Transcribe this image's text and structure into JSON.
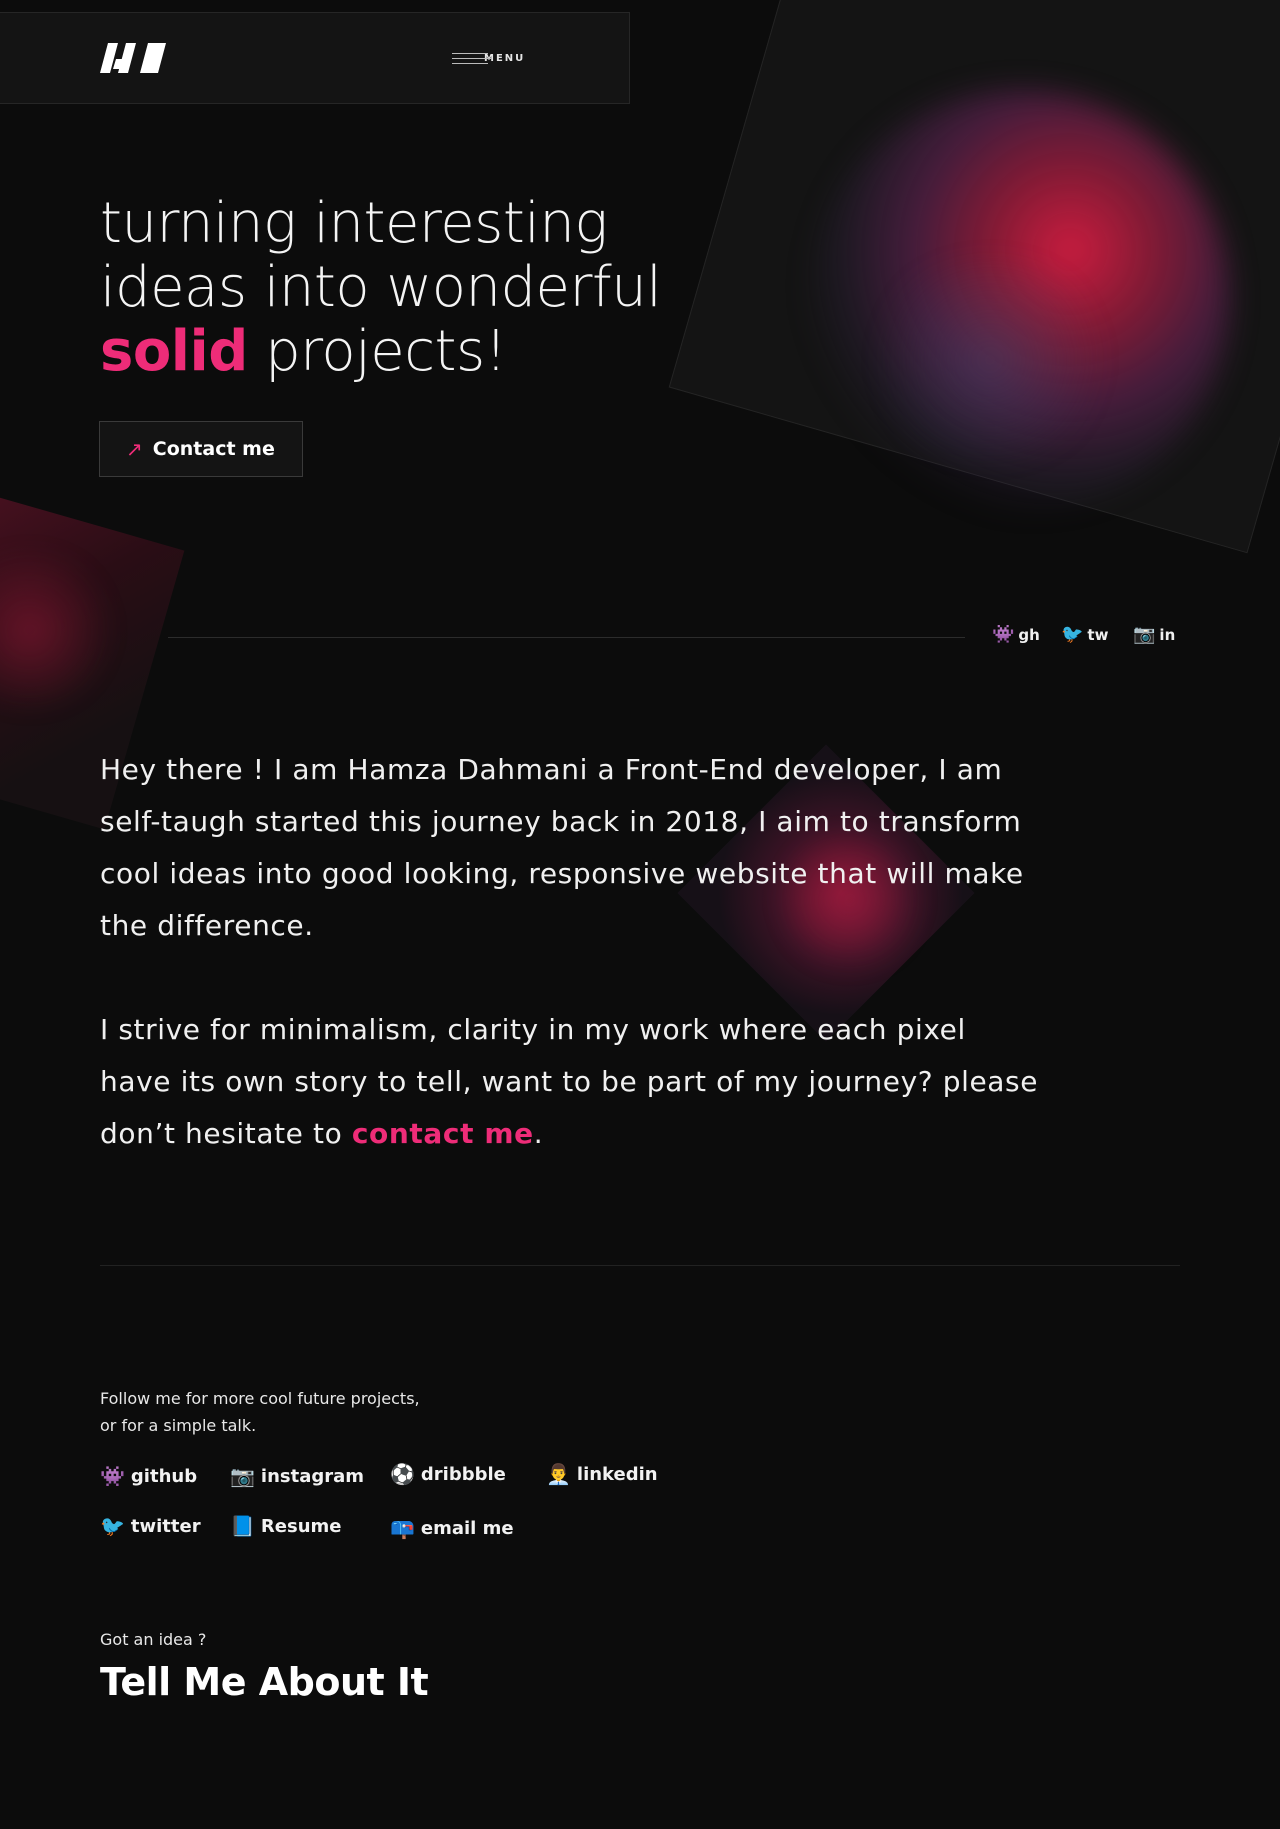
{
  "header": {
    "menu_label": "MENU"
  },
  "hero": {
    "line1": "turning interesting",
    "line2": "ideas into wonderful",
    "accent_word": "solid",
    "line3_rest": " projects!",
    "contact_button": "Contact me"
  },
  "mini_social": [
    {
      "label": "gh",
      "icon": "👾"
    },
    {
      "label": "tw",
      "icon": "🐦"
    },
    {
      "label": "in",
      "icon": "📷"
    }
  ],
  "about": {
    "para1": "Hey there ! I am Hamza Dahmani a Front-End developer, I am self-taugh started this journey back in 2018, I aim to transform cool ideas into good looking, responsive website that will make the difference.",
    "para2_text": "I strive for minimalism, clarity in my work where each pixel have its own story to tell, want to be part of my journey? please don’t hesitate to ",
    "para2_link": "contact me",
    "para2_end": "."
  },
  "follow": {
    "line1": "Follow me for more cool future projects,",
    "line2": "or for a simple talk."
  },
  "social_links": [
    {
      "label": "github",
      "icon": "👾"
    },
    {
      "label": "instagram",
      "icon": "📷"
    },
    {
      "label": "dribbble",
      "icon": "⚽"
    },
    {
      "label": "linkedin",
      "icon": "👨‍💼"
    },
    {
      "label": "twitter",
      "icon": "🐦"
    },
    {
      "label": "Resume",
      "icon": "📘"
    },
    {
      "label": "email me",
      "icon": "📪"
    }
  ],
  "cta": {
    "question": "Got an idea ?",
    "heading": "Tell Me About It"
  },
  "colors": {
    "accent": "#ee2c78",
    "background": "#0c0c0c",
    "panel": "#141414"
  }
}
